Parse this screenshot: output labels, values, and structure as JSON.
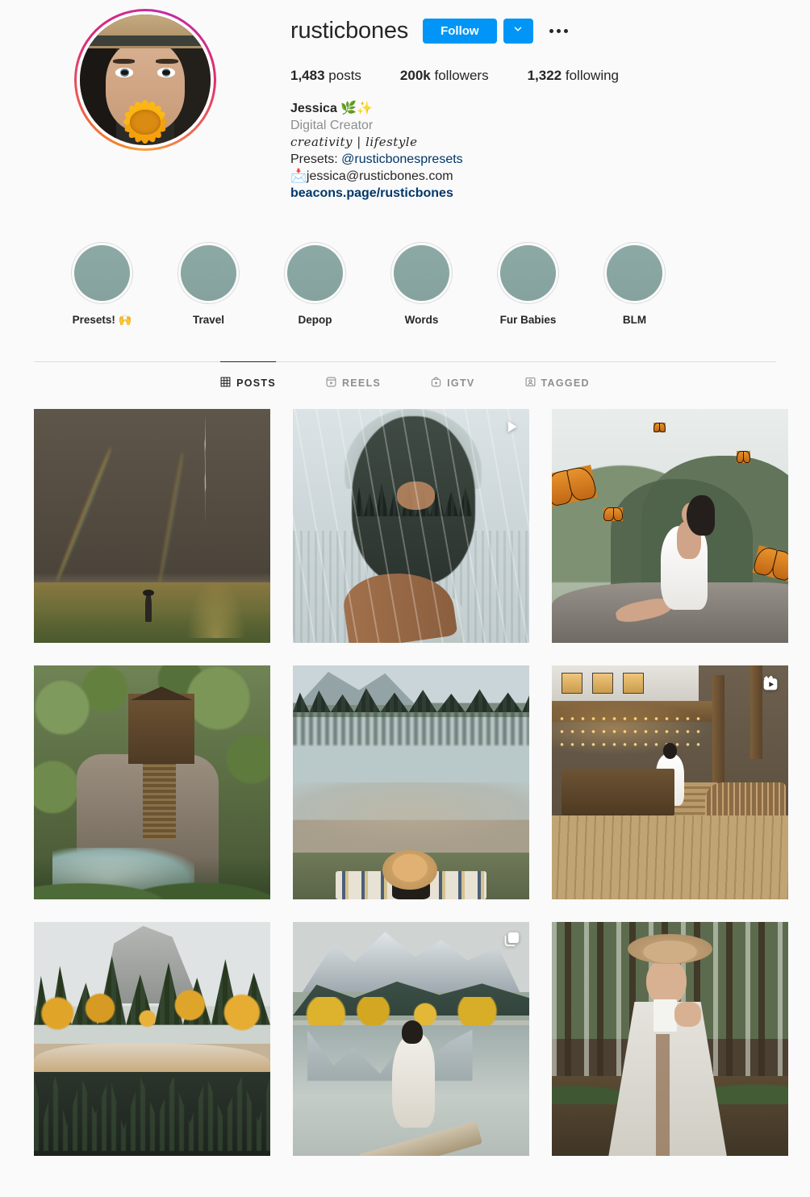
{
  "profile": {
    "username": "rusticbones",
    "avatar_alt": "woman-with-hat-holding-sunflower",
    "follow_label": "Follow",
    "dropdown_icon": "chevron-down-icon",
    "options_icon": "ellipsis-icon",
    "stats": [
      {
        "value": "1,483",
        "label": "posts"
      },
      {
        "value": "200k",
        "label": "followers"
      },
      {
        "value": "1,322",
        "label": "following"
      }
    ],
    "bio": {
      "full_name": "Jessica 🌿✨",
      "category": "Digital Creator",
      "script_line": "creativity | lifestyle",
      "presets_prefix": "Presets: ",
      "presets_mention": "@rusticbonespresets",
      "email_line": "📩jessica@rusticbones.com",
      "website": "beacons.page/rusticbones"
    }
  },
  "highlights": [
    {
      "label": "Presets! 🙌"
    },
    {
      "label": "Travel"
    },
    {
      "label": "Depop"
    },
    {
      "label": "Words"
    },
    {
      "label": "Fur Babies"
    },
    {
      "label": "BLM"
    }
  ],
  "tabs": [
    {
      "label": "POSTS",
      "icon": "grid-icon",
      "active": true
    },
    {
      "label": "REELS",
      "icon": "reels-icon",
      "active": false
    },
    {
      "label": "IGTV",
      "icon": "igtv-icon",
      "active": false
    },
    {
      "label": "TAGGED",
      "icon": "tagged-icon",
      "active": false
    }
  ],
  "posts": [
    {
      "alt": "double-rainbow-lightning-over-golden-field",
      "badge": null
    },
    {
      "alt": "double-exposure-portrait-forest-rain",
      "badge": "video-icon"
    },
    {
      "alt": "woman-white-dress-rock-monarch-butterflies",
      "badge": null
    },
    {
      "alt": "crystal-mill-wooden-cabin-on-cliff-river",
      "badge": null
    },
    {
      "alt": "woman-sun-hat-blanket-by-alpine-lake",
      "badge": null
    },
    {
      "alt": "wooden-deck-string-lights-woman-white-dress",
      "badge": "reels-icon"
    },
    {
      "alt": "yosemite-half-dome-autumn-reflection",
      "badge": null
    },
    {
      "alt": "three-sisters-mountains-woman-on-log",
      "badge": "carousel-icon"
    },
    {
      "alt": "woman-hat-blanket-pine-forest",
      "badge": null
    }
  ],
  "colors": {
    "accent_blue": "#0095f6",
    "link_blue": "#00376b",
    "text_primary": "#262626",
    "text_secondary": "#8e8e8e",
    "page_bg": "#fafafa",
    "border": "#dbdbdb",
    "highlight_cover": "#8ba8a4"
  }
}
